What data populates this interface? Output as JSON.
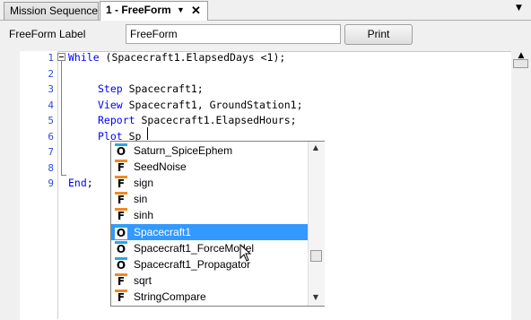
{
  "tabs": [
    {
      "label": "Mission Sequence"
    },
    {
      "label": "1 - FreeForm"
    }
  ],
  "toolbar": {
    "label": "FreeForm Label",
    "field_value": "FreeForm",
    "print_label": "Print"
  },
  "lines": [
    {
      "num": "1",
      "kw": "While",
      "rest": " (Spacecraft1.ElapsedDays <1);"
    },
    {
      "num": "2",
      "kw": "",
      "rest": ""
    },
    {
      "num": "3",
      "kw": "Step",
      "rest": " Spacecraft1;"
    },
    {
      "num": "4",
      "kw": "View",
      "rest": " Spacecraft1, GroundStation1;"
    },
    {
      "num": "5",
      "kw": "Report",
      "rest": " Spacecraft1.ElapsedHours;"
    },
    {
      "num": "6",
      "kw": "Plot",
      "rest": " Sp"
    },
    {
      "num": "7",
      "kw": "",
      "rest": ""
    },
    {
      "num": "8",
      "kw": "",
      "rest": ""
    },
    {
      "num": "9",
      "kw": "End",
      "rest": ";"
    }
  ],
  "autocomplete": {
    "items": [
      {
        "type": "O",
        "label": "Saturn_SpiceEphem"
      },
      {
        "type": "F",
        "label": "SeedNoise"
      },
      {
        "type": "F",
        "label": "sign"
      },
      {
        "type": "F",
        "label": "sin"
      },
      {
        "type": "F",
        "label": "sinh"
      },
      {
        "type": "O",
        "label": "Spacecraft1",
        "selected": true
      },
      {
        "type": "O",
        "label": "Spacecraft1_ForceModel"
      },
      {
        "type": "O",
        "label": "Spacecraft1_Propagator"
      },
      {
        "type": "F",
        "label": "sqrt"
      },
      {
        "type": "F",
        "label": "StringCompare"
      }
    ]
  },
  "colors": {
    "keyword": "#0000ff",
    "line_number": "#2b4fd6",
    "selection": "#3399ff",
    "object_badge": "#29a8e0",
    "function_badge": "#f08a24"
  }
}
